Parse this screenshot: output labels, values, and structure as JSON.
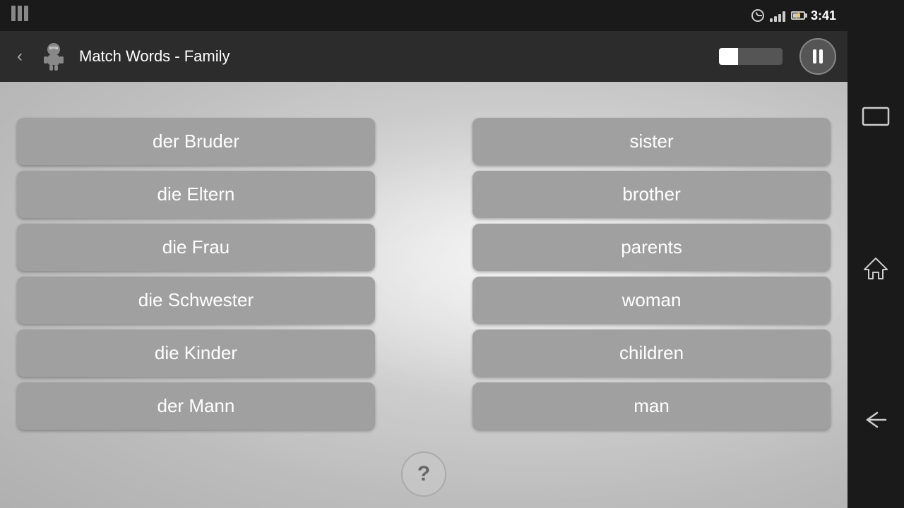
{
  "statusBar": {
    "time": "3:41"
  },
  "toolbar": {
    "title": "Match Words - Family",
    "progressPercent": 30,
    "pauseLabel": "pause"
  },
  "game": {
    "leftColumn": [
      "der Bruder",
      "die Eltern",
      "die Frau",
      "die Schwester",
      "die Kinder",
      "der Mann"
    ],
    "rightColumn": [
      "sister",
      "brother",
      "parents",
      "woman",
      "children",
      "man"
    ],
    "helpLabel": "?"
  }
}
